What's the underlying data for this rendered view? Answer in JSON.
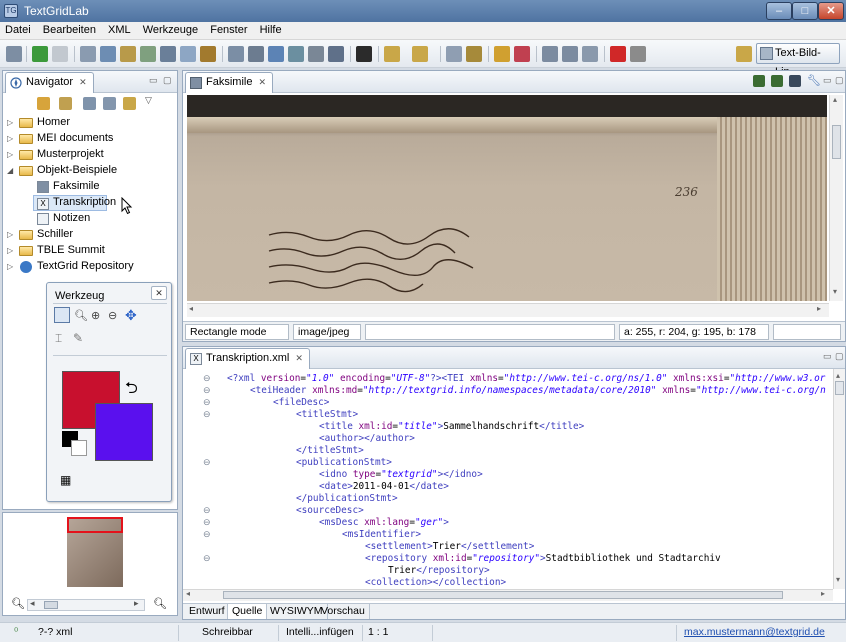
{
  "window": {
    "title": "TextGridLab",
    "minimize": "–",
    "maximize": "□",
    "close": "✕"
  },
  "menu": [
    "Datei",
    "Bearbeiten",
    "XML",
    "Werkzeuge",
    "Fenster",
    "Hilfe"
  ],
  "toolbar": {
    "perspective_label": "Text-Bild-Lin..."
  },
  "navigator": {
    "tab_label": "Navigator",
    "tree": [
      {
        "label": "Homer",
        "level": 0,
        "expanded": false
      },
      {
        "label": "MEI documents",
        "level": 0,
        "expanded": false
      },
      {
        "label": "Musterprojekt",
        "level": 0,
        "expanded": false
      },
      {
        "label": "Objekt-Beispiele",
        "level": 0,
        "expanded": true
      },
      {
        "label": "Faksimile",
        "level": 1
      },
      {
        "label": "Transkription",
        "level": 1,
        "selected": true
      },
      {
        "label": "Notizen",
        "level": 1
      },
      {
        "label": "Schiller",
        "level": 0,
        "expanded": false
      },
      {
        "label": "TBLE Summit",
        "level": 0,
        "expanded": false
      },
      {
        "label": "TextGrid Repository",
        "level": 0,
        "expanded": false
      }
    ]
  },
  "werkzeug": {
    "title": "Werkzeug",
    "fg_color": "#c8102e",
    "bg_color": "#5a10ee"
  },
  "faksimile": {
    "tab_label": "Faksimile",
    "page_number": "236",
    "status": {
      "mode": "Rectangle mode",
      "mime": "image/jpeg",
      "color_info": "a: 255, r: 204, g: 195, b: 178"
    }
  },
  "transkription": {
    "tab_label": "Transkription.xml",
    "lines": [
      {
        "indent": 0,
        "fold": true,
        "parts": [
          [
            "tg",
            "<?xml "
          ],
          [
            "at",
            "version"
          ],
          [
            "tx",
            "="
          ],
          [
            "av",
            "\"1.0\""
          ],
          [
            "tx",
            " "
          ],
          [
            "at",
            "encoding"
          ],
          [
            "tx",
            "="
          ],
          [
            "av",
            "\"UTF-8\""
          ],
          [
            "tg",
            "?><TEI "
          ],
          [
            "at",
            "xmlns"
          ],
          [
            "tx",
            "="
          ],
          [
            "av",
            "\"http://www.tei-c.org/ns/1.0\""
          ],
          [
            "tx",
            " "
          ],
          [
            "at",
            "xmlns:xsi"
          ],
          [
            "tx",
            "="
          ],
          [
            "av",
            "\"http://www.w3.or"
          ]
        ]
      },
      {
        "indent": 1,
        "fold": true,
        "parts": [
          [
            "tg",
            "<teiHeader "
          ],
          [
            "at",
            "xmlns:md"
          ],
          [
            "tx",
            "="
          ],
          [
            "av",
            "\"http://textgrid.info/namespaces/metadata/core/2010\""
          ],
          [
            "tx",
            " "
          ],
          [
            "at",
            "xmlns"
          ],
          [
            "tx",
            "="
          ],
          [
            "av",
            "\"http://www.tei-c.org/n"
          ]
        ]
      },
      {
        "indent": 2,
        "fold": true,
        "parts": [
          [
            "tg",
            "<fileDesc>"
          ]
        ]
      },
      {
        "indent": 3,
        "fold": true,
        "parts": [
          [
            "tg",
            "<titleStmt>"
          ]
        ]
      },
      {
        "indent": 4,
        "fold": false,
        "parts": [
          [
            "tg",
            "<title "
          ],
          [
            "at",
            "xml:id"
          ],
          [
            "tx",
            "="
          ],
          [
            "av",
            "\"title\""
          ],
          [
            "tg",
            ">"
          ],
          [
            "tx",
            "Sammelhandschrift"
          ],
          [
            "tg",
            "</title>"
          ]
        ]
      },
      {
        "indent": 4,
        "fold": false,
        "parts": [
          [
            "tg",
            "<author></author>"
          ]
        ]
      },
      {
        "indent": 3,
        "fold": false,
        "parts": [
          [
            "tg",
            "</titleStmt>"
          ]
        ]
      },
      {
        "indent": 3,
        "fold": true,
        "parts": [
          [
            "tg",
            "<publicationStmt>"
          ]
        ]
      },
      {
        "indent": 4,
        "fold": false,
        "parts": [
          [
            "tg",
            "<idno "
          ],
          [
            "at",
            "type"
          ],
          [
            "tx",
            "="
          ],
          [
            "av",
            "\"textgrid\""
          ],
          [
            "tg",
            "></idno>"
          ]
        ]
      },
      {
        "indent": 4,
        "fold": false,
        "parts": [
          [
            "tg",
            "<date>"
          ],
          [
            "tx",
            "2011-04-01"
          ],
          [
            "tg",
            "</date>"
          ]
        ]
      },
      {
        "indent": 3,
        "fold": false,
        "parts": [
          [
            "tg",
            "</publicationStmt>"
          ]
        ]
      },
      {
        "indent": 3,
        "fold": true,
        "parts": [
          [
            "tg",
            "<sourceDesc>"
          ]
        ]
      },
      {
        "indent": 4,
        "fold": true,
        "parts": [
          [
            "tg",
            "<msDesc "
          ],
          [
            "at",
            "xml:lang"
          ],
          [
            "tx",
            "="
          ],
          [
            "av",
            "\"ger\""
          ],
          [
            "tg",
            ">"
          ]
        ]
      },
      {
        "indent": 5,
        "fold": true,
        "parts": [
          [
            "tg",
            "<msIdentifier>"
          ]
        ]
      },
      {
        "indent": 6,
        "fold": false,
        "parts": [
          [
            "tg",
            "<settlement>"
          ],
          [
            "tx",
            "Trier"
          ],
          [
            "tg",
            "</settlement>"
          ]
        ]
      },
      {
        "indent": 6,
        "fold": true,
        "parts": [
          [
            "tg",
            "<repository "
          ],
          [
            "at",
            "xml:id"
          ],
          [
            "tx",
            "="
          ],
          [
            "av",
            "\"repository\""
          ],
          [
            "tg",
            ">"
          ],
          [
            "tx",
            "Stadtbibliothek und Stadtarchiv"
          ]
        ]
      },
      {
        "indent": 7,
        "fold": false,
        "parts": [
          [
            "tx",
            "Trier"
          ],
          [
            "tg",
            "</repository>"
          ]
        ]
      },
      {
        "indent": 6,
        "fold": false,
        "parts": [
          [
            "tg",
            "<collection></collection>"
          ]
        ]
      }
    ],
    "editor_tabs": [
      "Entwurf",
      "Quelle",
      "WYSIWYM",
      "Vorschau"
    ],
    "active_tab": "Quelle"
  },
  "statusbar": {
    "file": "?-? xml",
    "mode": "Schreibbar",
    "insert": "Intelli...infügen",
    "position": "1 : 1",
    "user": "max.mustermann@textgrid.de"
  }
}
